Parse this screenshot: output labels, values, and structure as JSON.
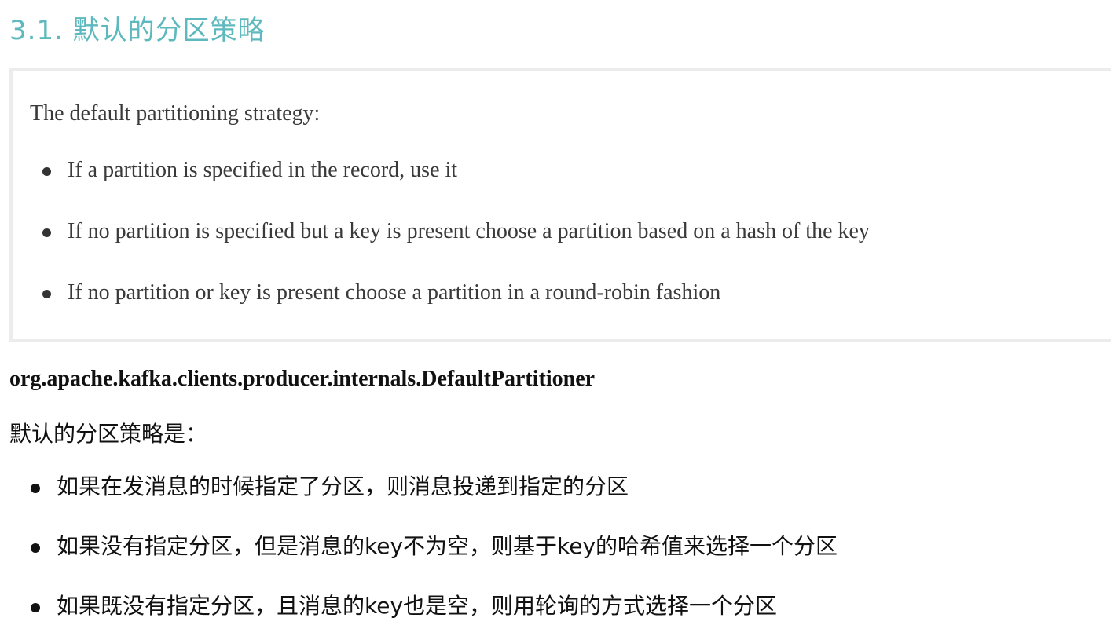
{
  "heading": {
    "text": "3.1. 默认的分区策略",
    "color": "#5db9bd"
  },
  "quote": {
    "intro": "The default partitioning strategy:",
    "items": [
      "If a partition is specified in the record, use it",
      "If no partition is specified but a key is present choose a partition based on a hash of the key",
      "If no partition or key is present choose a partition in a round-robin fashion"
    ]
  },
  "class_name": "org.apache.kafka.clients.producer.internals.DefaultPartitioner",
  "cn": {
    "intro": "默认的分区策略是：",
    "items": [
      "如果在发消息的时候指定了分区，则消息投递到指定的分区",
      "如果没有指定分区，但是消息的key不为空，则基于key的哈希值来选择一个分区",
      "如果既没有指定分区，且消息的key也是空，则用轮询的方式选择一个分区"
    ]
  }
}
